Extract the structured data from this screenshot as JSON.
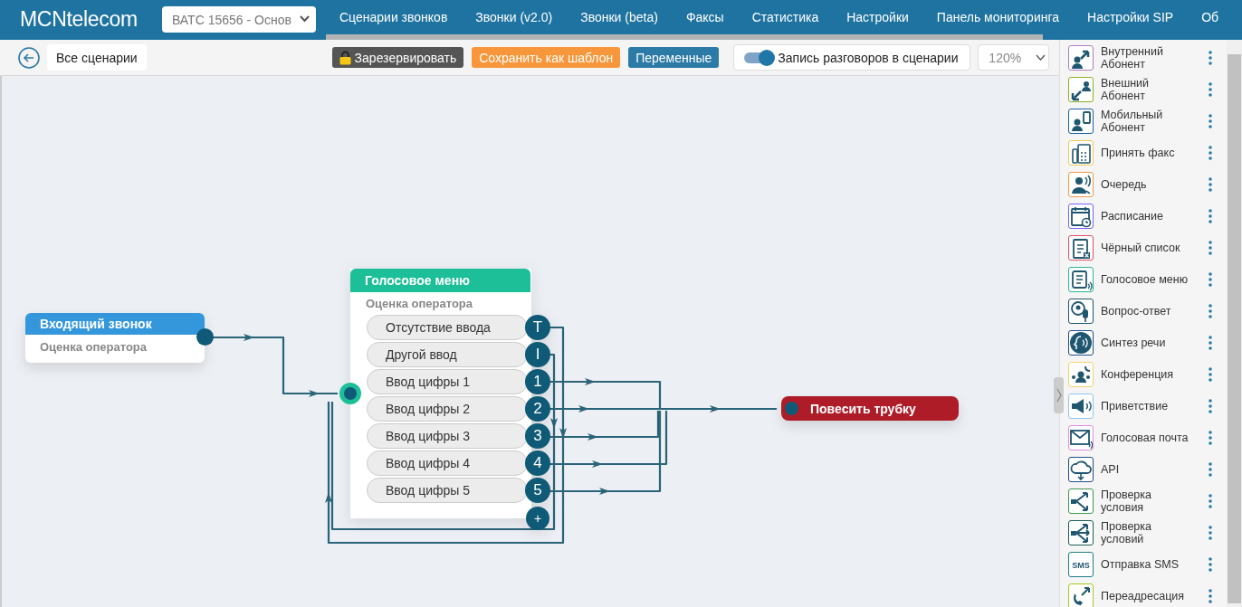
{
  "header": {
    "logo": "MCNtelecom",
    "account_select": "ВАТС 15656 - Основ",
    "nav": [
      {
        "label": "Сценарии звонков"
      },
      {
        "label": "Звонки (v2.0)"
      },
      {
        "label": "Звонки (beta)"
      },
      {
        "label": "Факсы"
      },
      {
        "label": "Статистика"
      },
      {
        "label": "Настройки"
      },
      {
        "label": "Панель мониторинга"
      },
      {
        "label": "Настройки SIP"
      },
      {
        "label": "Об"
      }
    ]
  },
  "toolbar": {
    "back_link": "Все сценарии",
    "buttons": [
      {
        "label": "Зарезервировать",
        "kind": "lock"
      },
      {
        "label": "Сохранить как шаблон",
        "kind": "template"
      },
      {
        "label": "Переменные",
        "kind": "variables"
      }
    ],
    "recording_toggle": {
      "label": "Запись разговоров в сценарии",
      "on": true
    },
    "zoom": "120%"
  },
  "canvas": {
    "nodes": [
      {
        "kind": "incoming",
        "title": "Входящий звонок",
        "subtitle": "Оценка оператора"
      },
      {
        "kind": "ivr",
        "title": "Голосовое меню",
        "subtitle": "Оценка оператора",
        "options": [
          {
            "label": "Отсутствие ввода",
            "port": "T"
          },
          {
            "label": "Другой ввод",
            "port": "I"
          },
          {
            "label": "Ввод цифры 1",
            "port": "1"
          },
          {
            "label": "Ввод цифры 2",
            "port": "2"
          },
          {
            "label": "Ввод цифры 3",
            "port": "3"
          },
          {
            "label": "Ввод цифры 4",
            "port": "4"
          },
          {
            "label": "Ввод цифры 5",
            "port": "5"
          }
        ],
        "add_port": "+"
      },
      {
        "kind": "hangup",
        "title": "Повесить трубку"
      }
    ]
  },
  "palette": {
    "items": [
      {
        "kind": "internal",
        "lines": [
          "Внутренний",
          "Абонент"
        ],
        "color": "#b07cc6"
      },
      {
        "kind": "external",
        "lines": [
          "Внешний",
          "Абонент"
        ],
        "color": "#8cb21e"
      },
      {
        "kind": "mobile",
        "lines": [
          "Мобильный",
          "Абонент"
        ],
        "color": "#1b5fa8"
      },
      {
        "kind": "fax",
        "lines": [
          "Принять факс"
        ],
        "color": "#f2c94c"
      },
      {
        "kind": "queue",
        "lines": [
          "Очередь"
        ],
        "color": "#f2994a"
      },
      {
        "kind": "schedule",
        "lines": [
          "Расписание"
        ],
        "color": "#7b61ff"
      },
      {
        "kind": "blacklist",
        "lines": [
          "Чёрный список"
        ],
        "color": "#e0506a"
      },
      {
        "kind": "ivr",
        "lines": [
          "Голосовое меню"
        ],
        "color": "#27b99a"
      },
      {
        "kind": "qa",
        "lines": [
          "Вопрос-ответ"
        ],
        "color": "#1f5670"
      },
      {
        "kind": "tts",
        "lines": [
          "Синтез речи"
        ],
        "color": "#1f4e8c"
      },
      {
        "kind": "conference",
        "lines": [
          "Конференция"
        ],
        "color": "#f2d46b"
      },
      {
        "kind": "greeting",
        "lines": [
          "Приветствие"
        ],
        "color": "#8ec5f0"
      },
      {
        "kind": "voicemail",
        "lines": [
          "Голосовая почта"
        ],
        "color": "#e88be0"
      },
      {
        "kind": "api",
        "lines": [
          "API"
        ],
        "color": "#1f4e8c"
      },
      {
        "kind": "condition",
        "lines": [
          "Проверка",
          "условия"
        ],
        "color": "#3a9a4a"
      },
      {
        "kind": "conditions",
        "lines": [
          "Проверка",
          "условий"
        ],
        "color": "#1f5f5a"
      },
      {
        "kind": "sms",
        "icon_text": "SMS",
        "lines": [
          "Отправка SMS"
        ],
        "color": "#1e7f8c"
      },
      {
        "kind": "redirect",
        "lines": [
          "Переадресация"
        ],
        "color": "#a8c81e"
      }
    ]
  }
}
